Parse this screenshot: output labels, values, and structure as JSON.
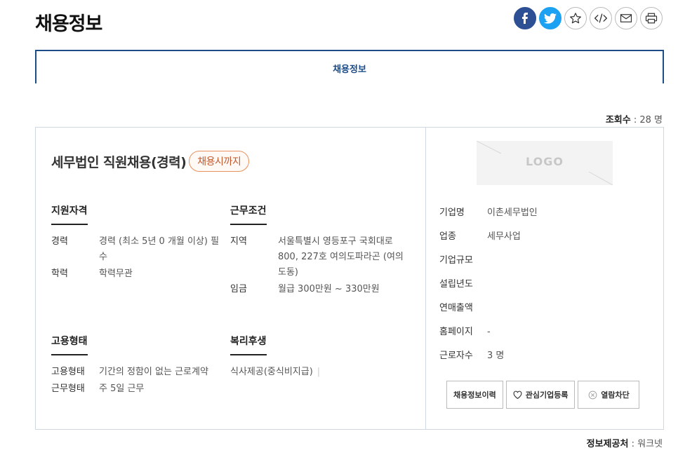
{
  "page": {
    "title": "채용정보"
  },
  "share": {
    "facebook_icon": "facebook-icon",
    "twitter_icon": "twitter-icon",
    "favorite_icon": "star-icon",
    "embed_icon": "code-icon",
    "email_icon": "mail-icon",
    "print_icon": "printer-icon"
  },
  "tabs": [
    {
      "label": "채용정보"
    }
  ],
  "stats": {
    "views_label": "조회수",
    "views_value": ": 28 명"
  },
  "job": {
    "title": "세무법인 직원채용(경력)",
    "deadline_badge": "채용시까지",
    "qualifications": {
      "title": "지원자격",
      "rows": [
        {
          "key": "경력",
          "value": "경력 (최소 5년 0 개월 이상) 필수"
        },
        {
          "key": "학력",
          "value": "학력무관"
        }
      ]
    },
    "conditions": {
      "title": "근무조건",
      "rows": [
        {
          "key": "지역",
          "value": "서울특별시 영등포구 국회대로 800, 227호 여의도파라곤 (여의도동)"
        },
        {
          "key": "임금",
          "value": "월급 300만원 ~ 330만원"
        }
      ]
    },
    "employment": {
      "title": "고용형태",
      "rows": [
        {
          "key": "고용형태",
          "value": "기간의 정함이 없는 근로계약"
        },
        {
          "key": "근무형태",
          "value": "주 5일 근무"
        }
      ]
    },
    "benefits": {
      "title": "복리후생",
      "value": "식사제공(중식비지급)",
      "separator": "|"
    }
  },
  "company": {
    "logo_text": "LOGO",
    "rows": [
      {
        "key": "기업명",
        "value": "이촌세무법인"
      },
      {
        "key": "업종",
        "value": "세무사업"
      },
      {
        "key": "기업규모",
        "value": ""
      },
      {
        "key": "설립년도",
        "value": ""
      },
      {
        "key": "연매출액",
        "value": ""
      },
      {
        "key": "홈페이지",
        "value": "-"
      },
      {
        "key": "근로자수",
        "value": "3 명"
      }
    ],
    "actions": {
      "history_label": "채용정보이력",
      "interest_label": "관심기업등록",
      "interest_icon": "heart-icon",
      "block_label": "열람차단",
      "block_icon": "block-icon"
    }
  },
  "footer": {
    "source_label": "정보제공처",
    "source_value": ": 워크넷"
  },
  "colors": {
    "accent": "#1d4d88",
    "badge": "#e8915e",
    "facebook": "#2d4f94",
    "twitter": "#1da1f2"
  }
}
